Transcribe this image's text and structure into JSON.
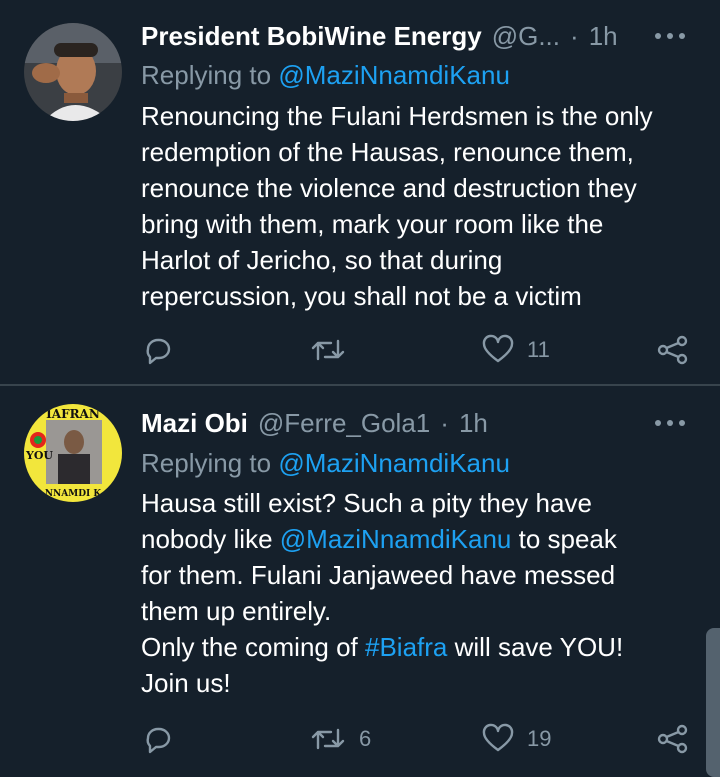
{
  "tweets": [
    {
      "name": "President BobiWine Energy",
      "handle": "@G...",
      "dot": "·",
      "time": "1h",
      "reply_prefix": "Replying to",
      "reply_to": "@MaziNnamdiKanu",
      "text_lines": [
        "Renouncing the Fulani Herdsmen is the only",
        "redemption of the Hausas, renounce them,",
        "renounce the violence and destruction they",
        "bring with them, mark your room like the",
        "Harlot of Jericho, so that during",
        "repercussion, you shall not be a victim"
      ],
      "retweets": "",
      "likes": "11"
    },
    {
      "name": "Mazi Obi",
      "handle": "@Ferre_Gola1",
      "dot": "·",
      "time": "1h",
      "reply_prefix": "Replying to",
      "reply_to": "@MaziNnamdiKanu",
      "text": {
        "l1": "Hausa still exist? Such a pity they have",
        "l2a": "nobody like ",
        "l2_mention": "@MaziNnamdiKanu",
        "l2b": " to speak",
        "l3": "for them. Fulani Janjaweed have messed",
        "l4": "them up entirely.",
        "l5a": "Only the coming of ",
        "l5_hashtag": "#Biafra",
        "l5b": " will save YOU!",
        "l6": "Join us!"
      },
      "avatar_text": {
        "top": "IAFRAN",
        "left": "YOU",
        "bottom": "NNAMDI K"
      },
      "retweets": "6",
      "likes": "19"
    }
  ],
  "colors": {
    "background": "#15202b",
    "secondary": "#8899a6",
    "link": "#1da1f2",
    "divider": "#38444d"
  },
  "icons": [
    "reply-icon",
    "retweet-icon",
    "like-icon",
    "share-icon",
    "more-icon"
  ]
}
